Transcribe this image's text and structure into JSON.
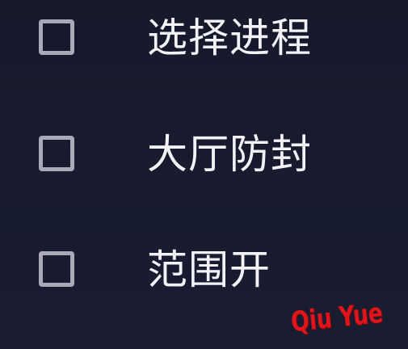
{
  "options": [
    {
      "label": "选择进程",
      "checked": false
    },
    {
      "label": "大厅防封",
      "checked": false
    },
    {
      "label": "范围开",
      "checked": false
    }
  ],
  "watermark": {
    "text": "Qiu Yue",
    "color": "#e0141b"
  },
  "colors": {
    "background": "#171a2c",
    "checkbox_border": "#a9a9b8",
    "label_text": "#f1f1f6"
  }
}
